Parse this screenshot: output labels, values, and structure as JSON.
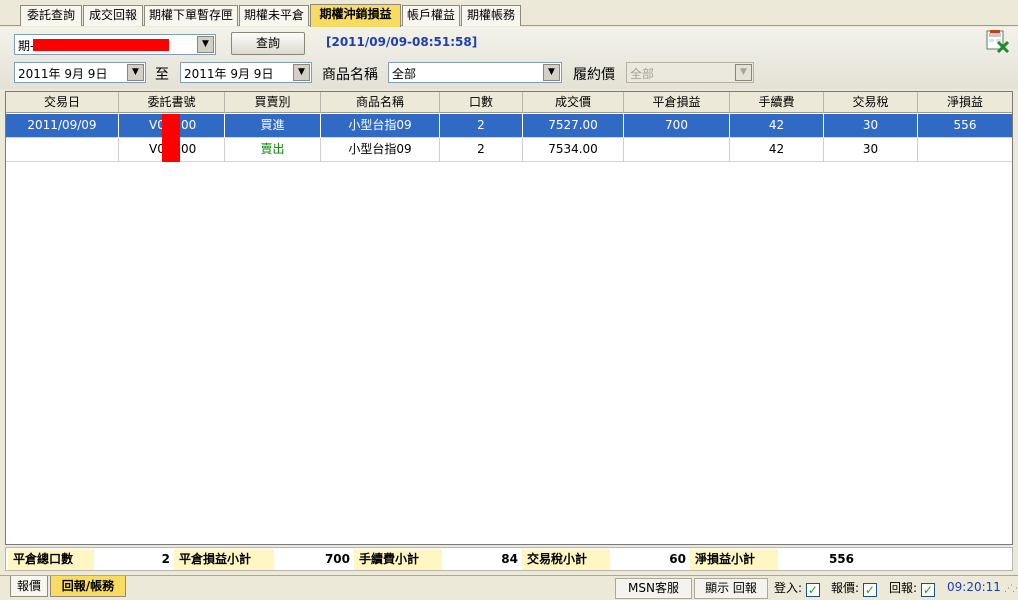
{
  "tabs": [
    {
      "label": "委託查詢",
      "active": false
    },
    {
      "label": "成交回報",
      "active": false
    },
    {
      "label": "期權下單暫存匣",
      "active": false
    },
    {
      "label": "期權未平倉",
      "active": false
    },
    {
      "label": "期權沖銷損益",
      "active": true
    },
    {
      "label": "帳戶權益",
      "active": false
    },
    {
      "label": "期權帳務",
      "active": false
    }
  ],
  "toolbar": {
    "account_prefix": "期-",
    "query_button": "查詢",
    "timestamp": "[2011/09/09-08:51:58]",
    "date_from": "2011年  9月  9日",
    "to_label": "至",
    "date_to": "2011年  9月  9日",
    "product_label": "商品名稱",
    "product_value": "全部",
    "strike_label": "履約價",
    "strike_value": "全部",
    "export_icon": "excel-export-icon"
  },
  "grid": {
    "columns": [
      "交易日",
      "委託書號",
      "買賣別",
      "商品名稱",
      "口數",
      "成交價",
      "平倉損益",
      "手續費",
      "交易稅",
      "淨損益"
    ],
    "rows": [
      {
        "date": "2011/09/09",
        "order_no": "V0",
        "order_no_tail": "00",
        "side": "買進",
        "product": "小型台指09",
        "qty": "2",
        "price": "7527.00",
        "pnl": "700",
        "fee": "42",
        "tax": "30",
        "net": "556",
        "selected": true
      },
      {
        "date": "",
        "order_no": "V0",
        "order_no_tail": "00",
        "side": "賣出",
        "product": "小型台指09",
        "qty": "2",
        "price": "7534.00",
        "pnl": "",
        "fee": "42",
        "tax": "30",
        "net": "",
        "selected": false
      }
    ]
  },
  "summary": {
    "total_qty_label": "平倉總口數",
    "total_qty": "2",
    "pnl_subtotal_label": "平倉損益小計",
    "pnl_subtotal": "700",
    "fee_subtotal_label": "手續費小計",
    "fee_subtotal": "84",
    "tax_subtotal_label": "交易稅小計",
    "tax_subtotal": "60",
    "net_subtotal_label": "淨損益小計",
    "net_subtotal": "556"
  },
  "statusbar": {
    "tabs": [
      {
        "label": "報價",
        "active": false
      },
      {
        "label": "回報/帳務",
        "active": true
      }
    ],
    "msn_button": "MSN客服",
    "report_button": "顯示 回報",
    "login_label": "登入:",
    "quote_label": "報價:",
    "reply_label": "回報:",
    "check_mark": "✓",
    "clock": "09:20:11"
  },
  "colors": {
    "selected_row": "#316ac5",
    "active_tab": "#f8dc62",
    "sell_text": "#078a07",
    "timestamp_text": "#1f3fae",
    "redaction": "#ff0000"
  }
}
